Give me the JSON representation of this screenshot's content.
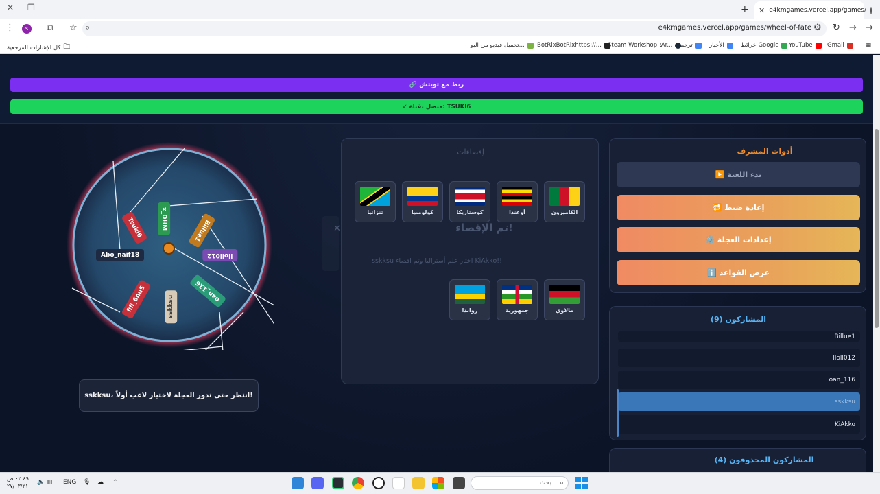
{
  "browser": {
    "tab_title": "e4kmgames.vercel.app/games/",
    "tab_close": "✕",
    "new_tab": "+",
    "url": "e4kmgames.vercel.app/games/wheel-of-fate",
    "profile_initial": "s",
    "bookmarks": [
      {
        "label": "Gmail",
        "color": "#d93025"
      },
      {
        "label": "YouTube",
        "color": "#ff0000"
      },
      {
        "label": "خرائط Google",
        "color": "#34a853"
      },
      {
        "label": "الأخبار",
        "color": "#4285f4"
      },
      {
        "label": "ترجمة",
        "color": "#4285f4"
      },
      {
        "label": "Steam Workshop::Ar...",
        "color": "#1b2838"
      },
      {
        "label": "BotRixBotRixhttps://...",
        "color": "#222222"
      },
      {
        "label": "تحميل فيديو من اليو...",
        "color": "#7cb342"
      }
    ],
    "all_bookmarks": "كل الإشارات المرجعية"
  },
  "page": {
    "twitch_connect": "🔗 ربط مع تويتش",
    "connected": "✓ متصل بقناة: TSUKI6"
  },
  "wheel": {
    "names": [
      "Billue1",
      "lloll012",
      "oan_116",
      "sskksu",
      "KiAkko",
      "Tsuki6",
      "x_DHM",
      "Abo_naif18",
      "fifi_6nuS"
    ],
    "wait_message": "sskksu، انتظر حتى تدور العجلة لاختيار لاعب أولاً!"
  },
  "center": {
    "title": "إقصاءات",
    "flags_top": [
      {
        "label": "الكاميرون",
        "flag": "cameroon"
      },
      {
        "label": "أوغندا",
        "flag": "uganda"
      },
      {
        "label": "كوستاريكا",
        "flag": "costarica"
      },
      {
        "label": "كولومبيا",
        "flag": "colombia"
      },
      {
        "label": "تنزانيا",
        "flag": "tanzania"
      }
    ],
    "elim_title": "تم الإقصاء!",
    "elim_message": "sskksu اختار علم أستراليا وتم اقصاء KiAkko!!",
    "close": "✕",
    "flags_bottom": [
      {
        "label": "مالاوي",
        "flag": "malawi"
      },
      {
        "label": "جمهورية",
        "flag": "car"
      },
      {
        "label": "رواندا",
        "flag": "rwanda"
      }
    ]
  },
  "admin": {
    "title": "أدوات المشرف",
    "start": "▶️ بدء اللعبة",
    "reset": "🔁 إعادة ضبط",
    "wheel_settings": "⚙️ إعدادات العجلة",
    "rules": "ℹ️ عرض القواعد"
  },
  "participants": {
    "title": "المشاركون (9)",
    "items": [
      "Billue1",
      "lloll012",
      "oan_116",
      "sskksu",
      "KiAkko"
    ],
    "selected_index": 3
  },
  "eliminated": {
    "title": "المشاركون المحذوفون (4)"
  },
  "taskbar": {
    "search_placeholder": "بحث",
    "lang": "ENG",
    "time": "٠٢:٤٩ ص",
    "date": "٢٧/٠٣/٢١"
  }
}
